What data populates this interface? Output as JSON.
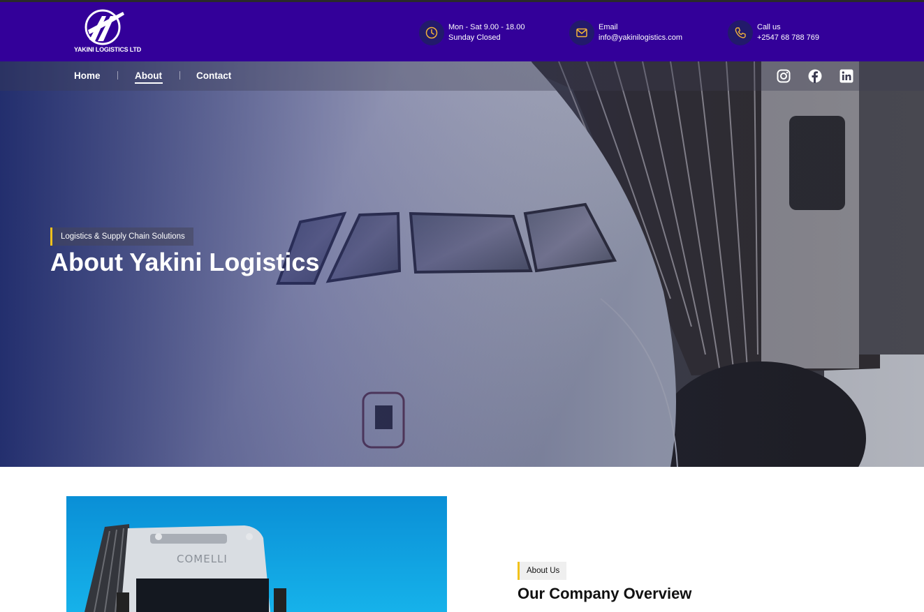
{
  "brand": {
    "logo_text": "YAKINI LOGISTICS LTD"
  },
  "header": {
    "hours": {
      "line1": "Mon - Sat 9.00 - 18.00",
      "line2": "Sunday Closed",
      "icon": "clock-icon"
    },
    "email": {
      "label": "Email",
      "value": "info@yakinilogistics.com",
      "icon": "mail-icon"
    },
    "phone": {
      "label": "Call us",
      "value": "+2547 68 788 769",
      "icon": "phone-icon"
    }
  },
  "nav": {
    "items": [
      {
        "label": "Home",
        "active": false
      },
      {
        "label": "About",
        "active": true
      },
      {
        "label": "Contact",
        "active": false
      }
    ],
    "social": [
      "instagram-icon",
      "facebook-icon",
      "linkedin-icon"
    ]
  },
  "hero": {
    "tagline": "Logistics & Supply Chain Solutions",
    "title": "About Yakini Logistics"
  },
  "overview": {
    "badge": "About Us",
    "title": "Our Company Overview"
  },
  "colors": {
    "header_bg": "#330099",
    "accent": "#f2c21b",
    "icon_circle": "#221a6b"
  }
}
